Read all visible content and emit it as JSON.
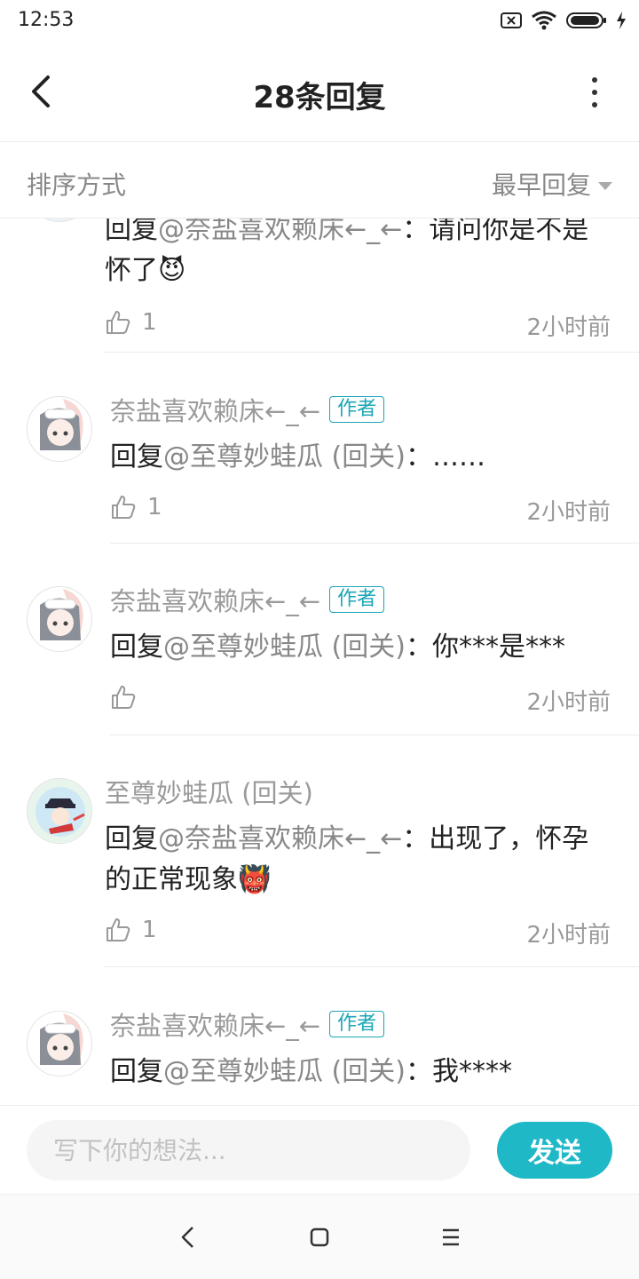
{
  "status_bar": {
    "time": "12:53"
  },
  "header": {
    "title": "28条回复"
  },
  "sort": {
    "label": "排序方式",
    "selected": "最早回复"
  },
  "comments": [
    {
      "content_prefix": "回复",
      "mention": "@奈盐喜欢赖床←_←",
      "text": "：请问你是不是怀了",
      "emoji": "😈",
      "likes": "1",
      "time": "2小时前"
    },
    {
      "username": "奈盐喜欢赖床←_←",
      "badge": "作者",
      "content_prefix": "回复",
      "mention": "@至尊妙蛙瓜 (回关)",
      "text": "：……",
      "likes": "1",
      "time": "2小时前"
    },
    {
      "username": "奈盐喜欢赖床←_←",
      "badge": "作者",
      "content_prefix": "回复",
      "mention": "@至尊妙蛙瓜 (回关)",
      "text": "：你***是***",
      "likes": "",
      "time": "2小时前"
    },
    {
      "username": "至尊妙蛙瓜 (回关)",
      "content_prefix": "回复",
      "mention": "@奈盐喜欢赖床←_←",
      "text": "：出现了，怀孕的正常现象",
      "emoji": "👹",
      "likes": "1",
      "time": "2小时前"
    },
    {
      "username": "奈盐喜欢赖床←_←",
      "badge": "作者",
      "content_prefix": "回复",
      "mention": "@至尊妙蛙瓜 (回关)",
      "text": "：我****"
    }
  ],
  "composer": {
    "placeholder": "写下你的想法...",
    "send_label": "发送"
  },
  "colors": {
    "accent": "#1fb8c7",
    "badge": "#1aa6b7"
  }
}
